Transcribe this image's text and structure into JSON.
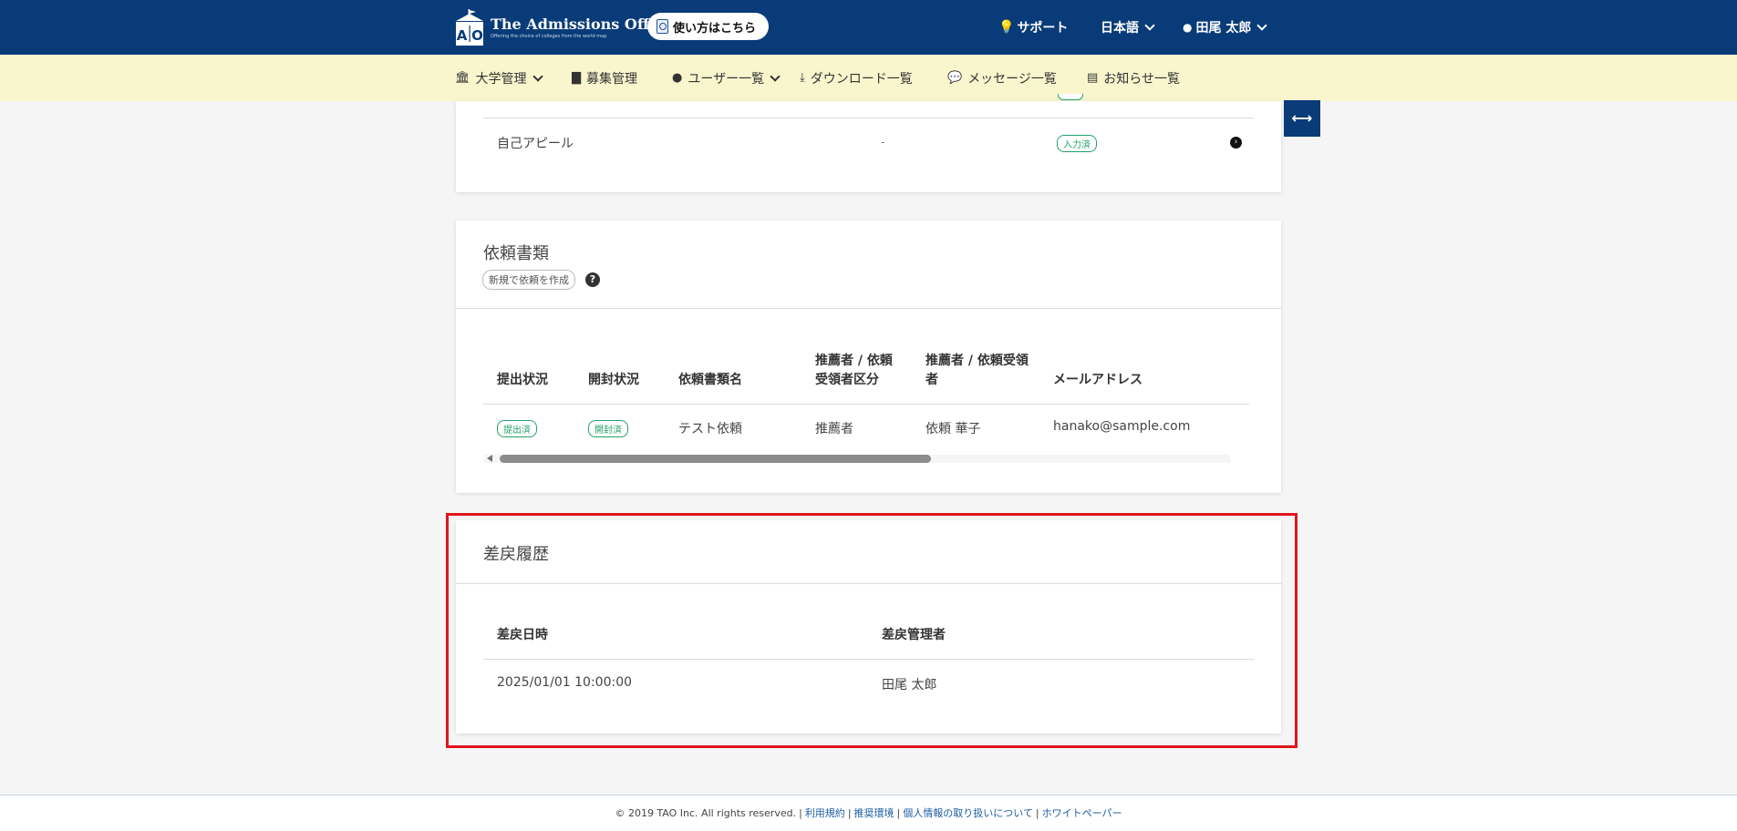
{
  "header": {
    "logo_title": "The Admissions Office",
    "logo_tagline": "Offering the choice of colleges from the world map",
    "howto_label": "使い方はこちら",
    "support_label": "サポート",
    "language_label": "日本語",
    "user_name": "田尾 太郎"
  },
  "nav": {
    "items": [
      {
        "label": "大学管理",
        "icon": "university-icon"
      },
      {
        "label": "募集管理",
        "icon": "document-icon"
      },
      {
        "label": "ユーザー一覧",
        "icon": "user-icon"
      },
      {
        "label": "ダウンロード一覧",
        "icon": "download-icon"
      },
      {
        "label": "メッセージ一覧",
        "icon": "message-icon"
      },
      {
        "label": "お知らせ一覧",
        "icon": "notice-icon"
      }
    ]
  },
  "self_appeal": {
    "label": "自己アピール",
    "value": "-",
    "status": "入力済"
  },
  "requests": {
    "title": "依頼書類",
    "create_button": "新規で依頼を作成",
    "headers": [
      "提出状況",
      "開封状況",
      "依頼書類名",
      "推薦者 / 依頼受領者区分",
      "推薦者 / 依頼受領者",
      "メールアドレス"
    ],
    "header_lines": {
      "col3_line1": "推薦者 / 依頼",
      "col3_line2": "受領者区分",
      "col4_line1": "推薦者 / 依頼受領",
      "col4_line2": "者"
    },
    "rows": [
      {
        "submit_status": "提出済",
        "open_status": "開封済",
        "document_name": "テスト依頼",
        "category": "推薦者",
        "recipient": "依頼 華子",
        "email": "hanako@sample.com"
      }
    ]
  },
  "return_history": {
    "title": "差戻履歴",
    "headers": [
      "差戻日時",
      "差戻管理者"
    ],
    "rows": [
      {
        "datetime": "2025/01/01 10:00:00",
        "admin": "田尾 太郎"
      }
    ]
  },
  "footer": {
    "copyright": "© 2019 TAO Inc. All rights reserved.",
    "links": [
      "利用規約",
      "推奨環境",
      "個人情報の取り扱いについて",
      "ホワイトペーパー"
    ]
  },
  "colors": {
    "header_bg": "#083b78",
    "nav_bg": "#f9f5cd",
    "status_green": "#22a36b",
    "highlight_red": "#e0151d"
  }
}
